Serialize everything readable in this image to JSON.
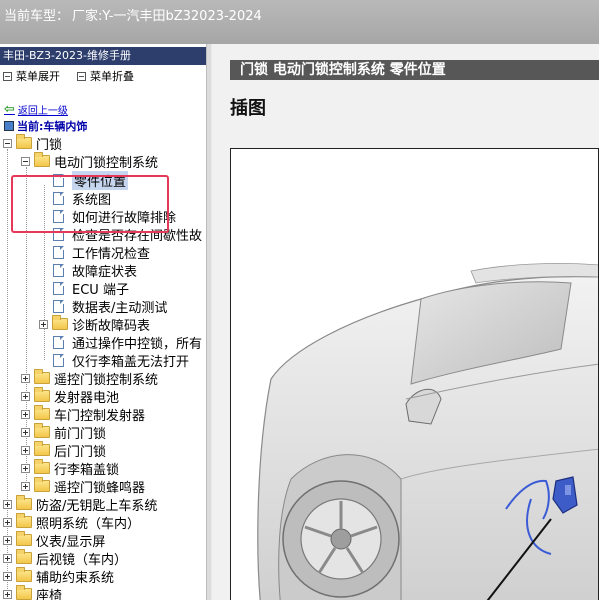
{
  "vehicle_bar": {
    "label": "当前车型：",
    "value": "厂家:Y-一汽丰田bZ32023-2024"
  },
  "sidebar": {
    "manual_title": "丰田-BZ3-2023-维修手册",
    "expand_label": "菜单展开",
    "collapse_label": "菜单折叠",
    "back_label": "返回上一级",
    "current_label": "当前:车辆内饰",
    "tree": {
      "door_lock": "门锁",
      "power_door_lock": "电动门锁控制系统",
      "children": [
        "零件位置",
        "系统图",
        "如何进行故障排除",
        "检查是否存在间歇性故",
        "工作情况检查",
        "故障症状表",
        "ECU 端子",
        "数据表/主动测试",
        "诊断故障码表",
        "通过操作中控锁，所有",
        "仅行李箱盖无法打开"
      ],
      "door_lock_siblings": [
        "遥控门锁控制系统",
        "发射器电池",
        "车门控制发射器",
        "前门门锁",
        "后门门锁",
        "行李箱盖锁",
        "遥控门锁蜂鸣器"
      ],
      "top_level": [
        "防盗/无钥匙上车系统",
        "照明系统（车内）",
        "仪表/显示屏",
        "后视镜（车内）",
        "辅助约束系统",
        "座椅"
      ]
    }
  },
  "content": {
    "title": "门锁  电动门锁控制系统  零件位置",
    "section": "插图"
  },
  "colors": {
    "title_bar": "#575757",
    "manual_bar": "#2d3e6d",
    "highlight": "#e8385a",
    "selection": "#c6d6ee"
  }
}
